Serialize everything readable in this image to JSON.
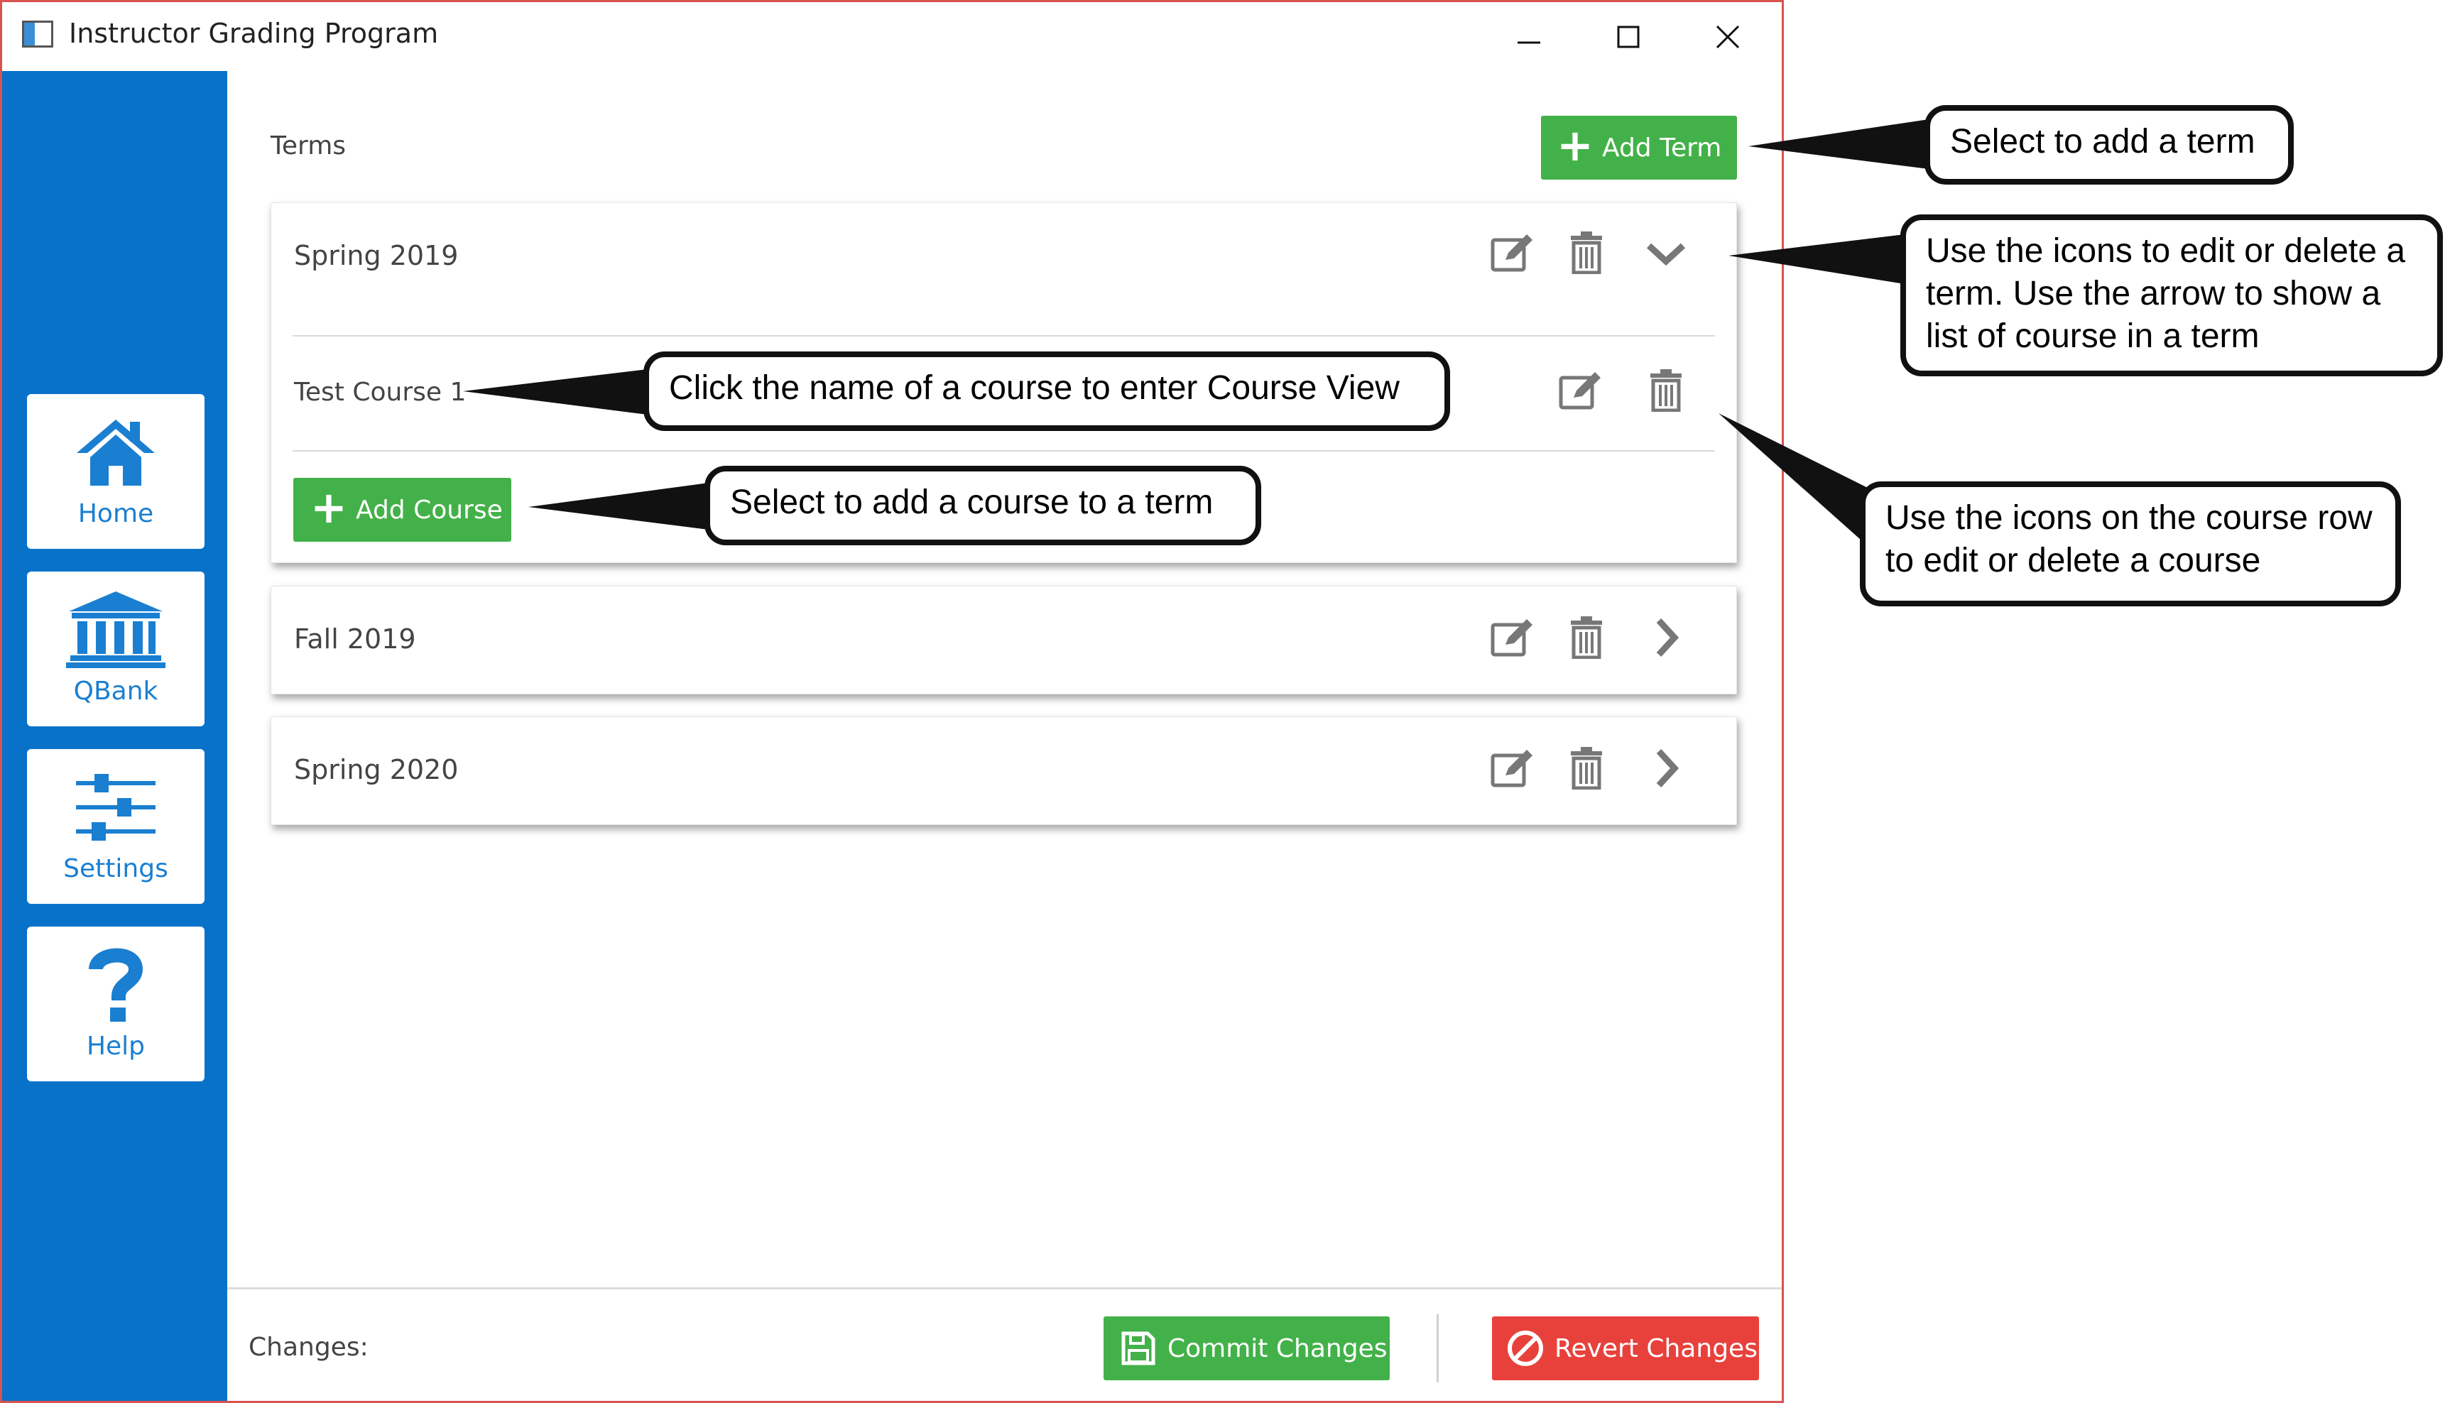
{
  "window": {
    "title": "Instructor Grading Program"
  },
  "sidebar": {
    "items": [
      {
        "label": "Home",
        "icon": "home-icon"
      },
      {
        "label": "QBank",
        "icon": "bank-icon"
      },
      {
        "label": "Settings",
        "icon": "sliders-icon"
      },
      {
        "label": "Help",
        "icon": "question-icon"
      }
    ]
  },
  "main": {
    "terms_label": "Terms",
    "add_term_label": "Add Term",
    "terms": [
      {
        "name": "Spring 2019",
        "expanded": true,
        "courses": [
          {
            "name": "Test Course 1"
          }
        ],
        "add_course_label": "Add Course"
      },
      {
        "name": "Fall 2019",
        "expanded": false
      },
      {
        "name": "Spring 2020",
        "expanded": false
      }
    ]
  },
  "footer": {
    "changes_label": "Changes:",
    "commit_label": "Commit Changes",
    "revert_label": "Revert Changes"
  },
  "callouts": {
    "add_term": "Select to add a term",
    "edit_term": "Use the icons to edit or delete a term. Use the arrow to show a list of course in a term",
    "course_view": "Click the name of a course to enter Course View",
    "add_course": "Select to add a course to a term",
    "course_icons": "Use the icons on the course row to edit or delete a course"
  },
  "colors": {
    "sidebar": "#0872c9",
    "accent_green": "#43b149",
    "revert_red": "#e8413c",
    "window_border": "#d9534f"
  }
}
